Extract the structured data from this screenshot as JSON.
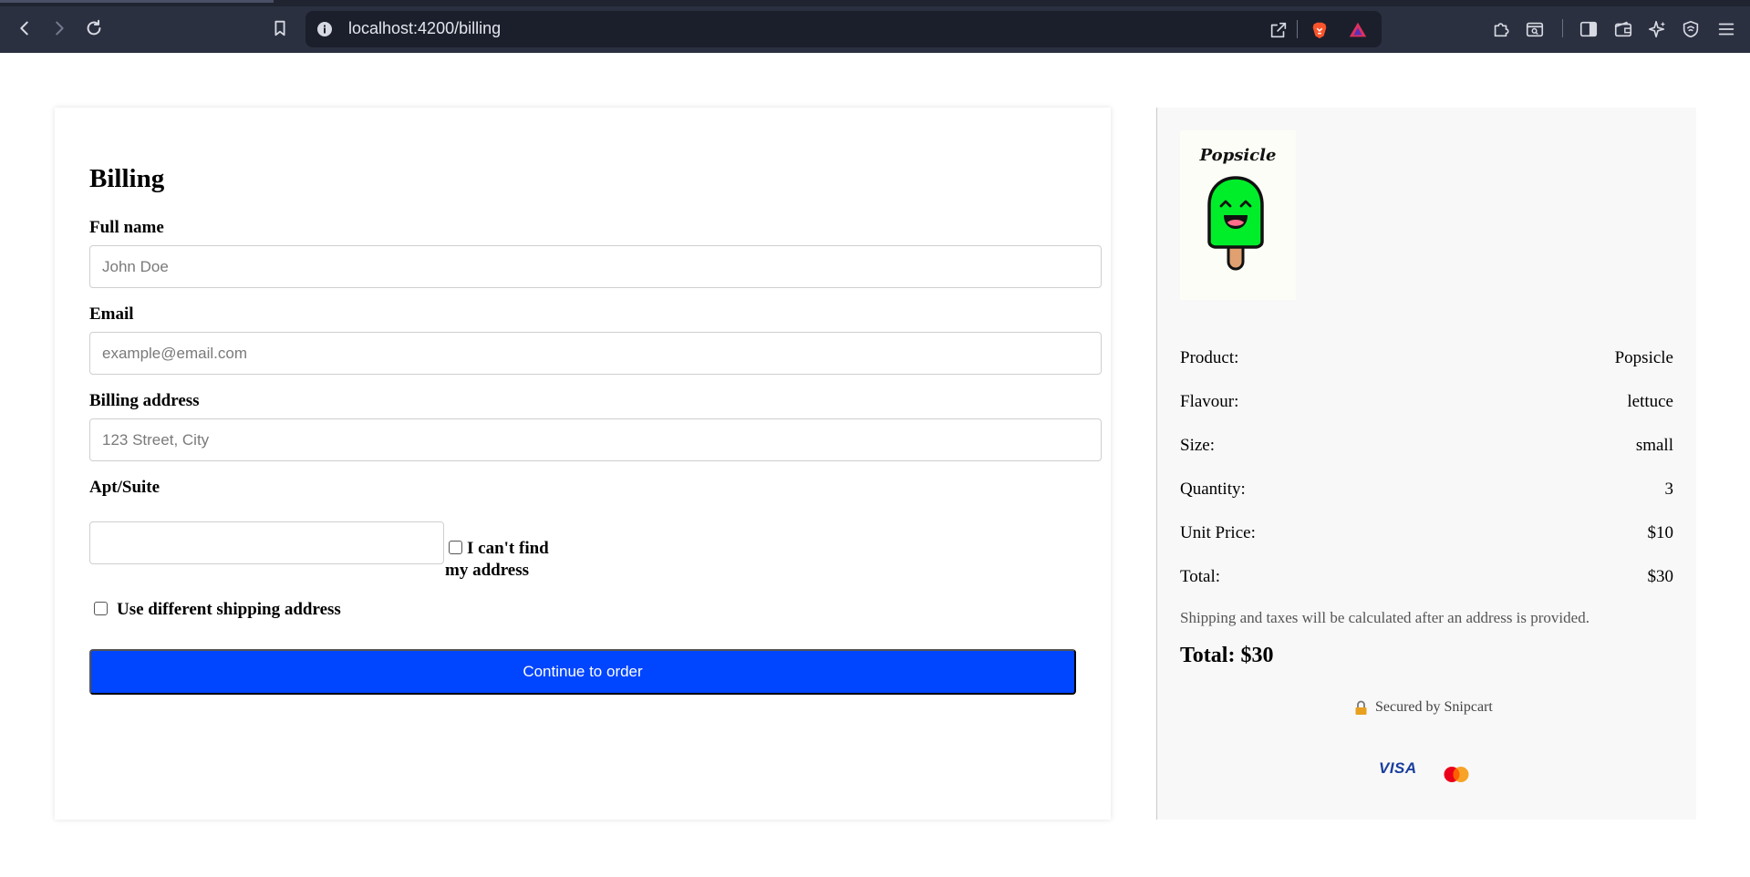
{
  "browser": {
    "url": "localhost:4200/billing"
  },
  "billing": {
    "title": "Billing",
    "full_name_label": "Full name",
    "full_name_placeholder": "John Doe",
    "email_label": "Email",
    "email_placeholder": "example@email.com",
    "address_label": "Billing address",
    "address_placeholder": "123 Street, City",
    "apt_label": "Apt/Suite",
    "cant_find_label": "I can't find my address",
    "shipping_checkbox_label": "Use different shipping address",
    "continue_button": "Continue to order"
  },
  "summary": {
    "brand": "Popsicle",
    "rows": [
      {
        "label": "Product:",
        "value": "Popsicle"
      },
      {
        "label": "Flavour:",
        "value": "lettuce"
      },
      {
        "label": "Size:",
        "value": "small"
      },
      {
        "label": "Quantity:",
        "value": "3"
      },
      {
        "label": "Unit Price:",
        "value": "$10"
      },
      {
        "label": "Total:",
        "value": "$30"
      }
    ],
    "shipping_note": "Shipping and taxes will be calculated after an address is provided.",
    "grand_total": "Total: $30",
    "secured_text": "Secured by Snipcart",
    "card_brands": {
      "visa": "VISA",
      "mastercard": "mastercard-icon"
    }
  },
  "colors": {
    "accent": "#0045ff",
    "popsicle_green": "#00ee2a",
    "chrome_bg": "#2b3041"
  }
}
